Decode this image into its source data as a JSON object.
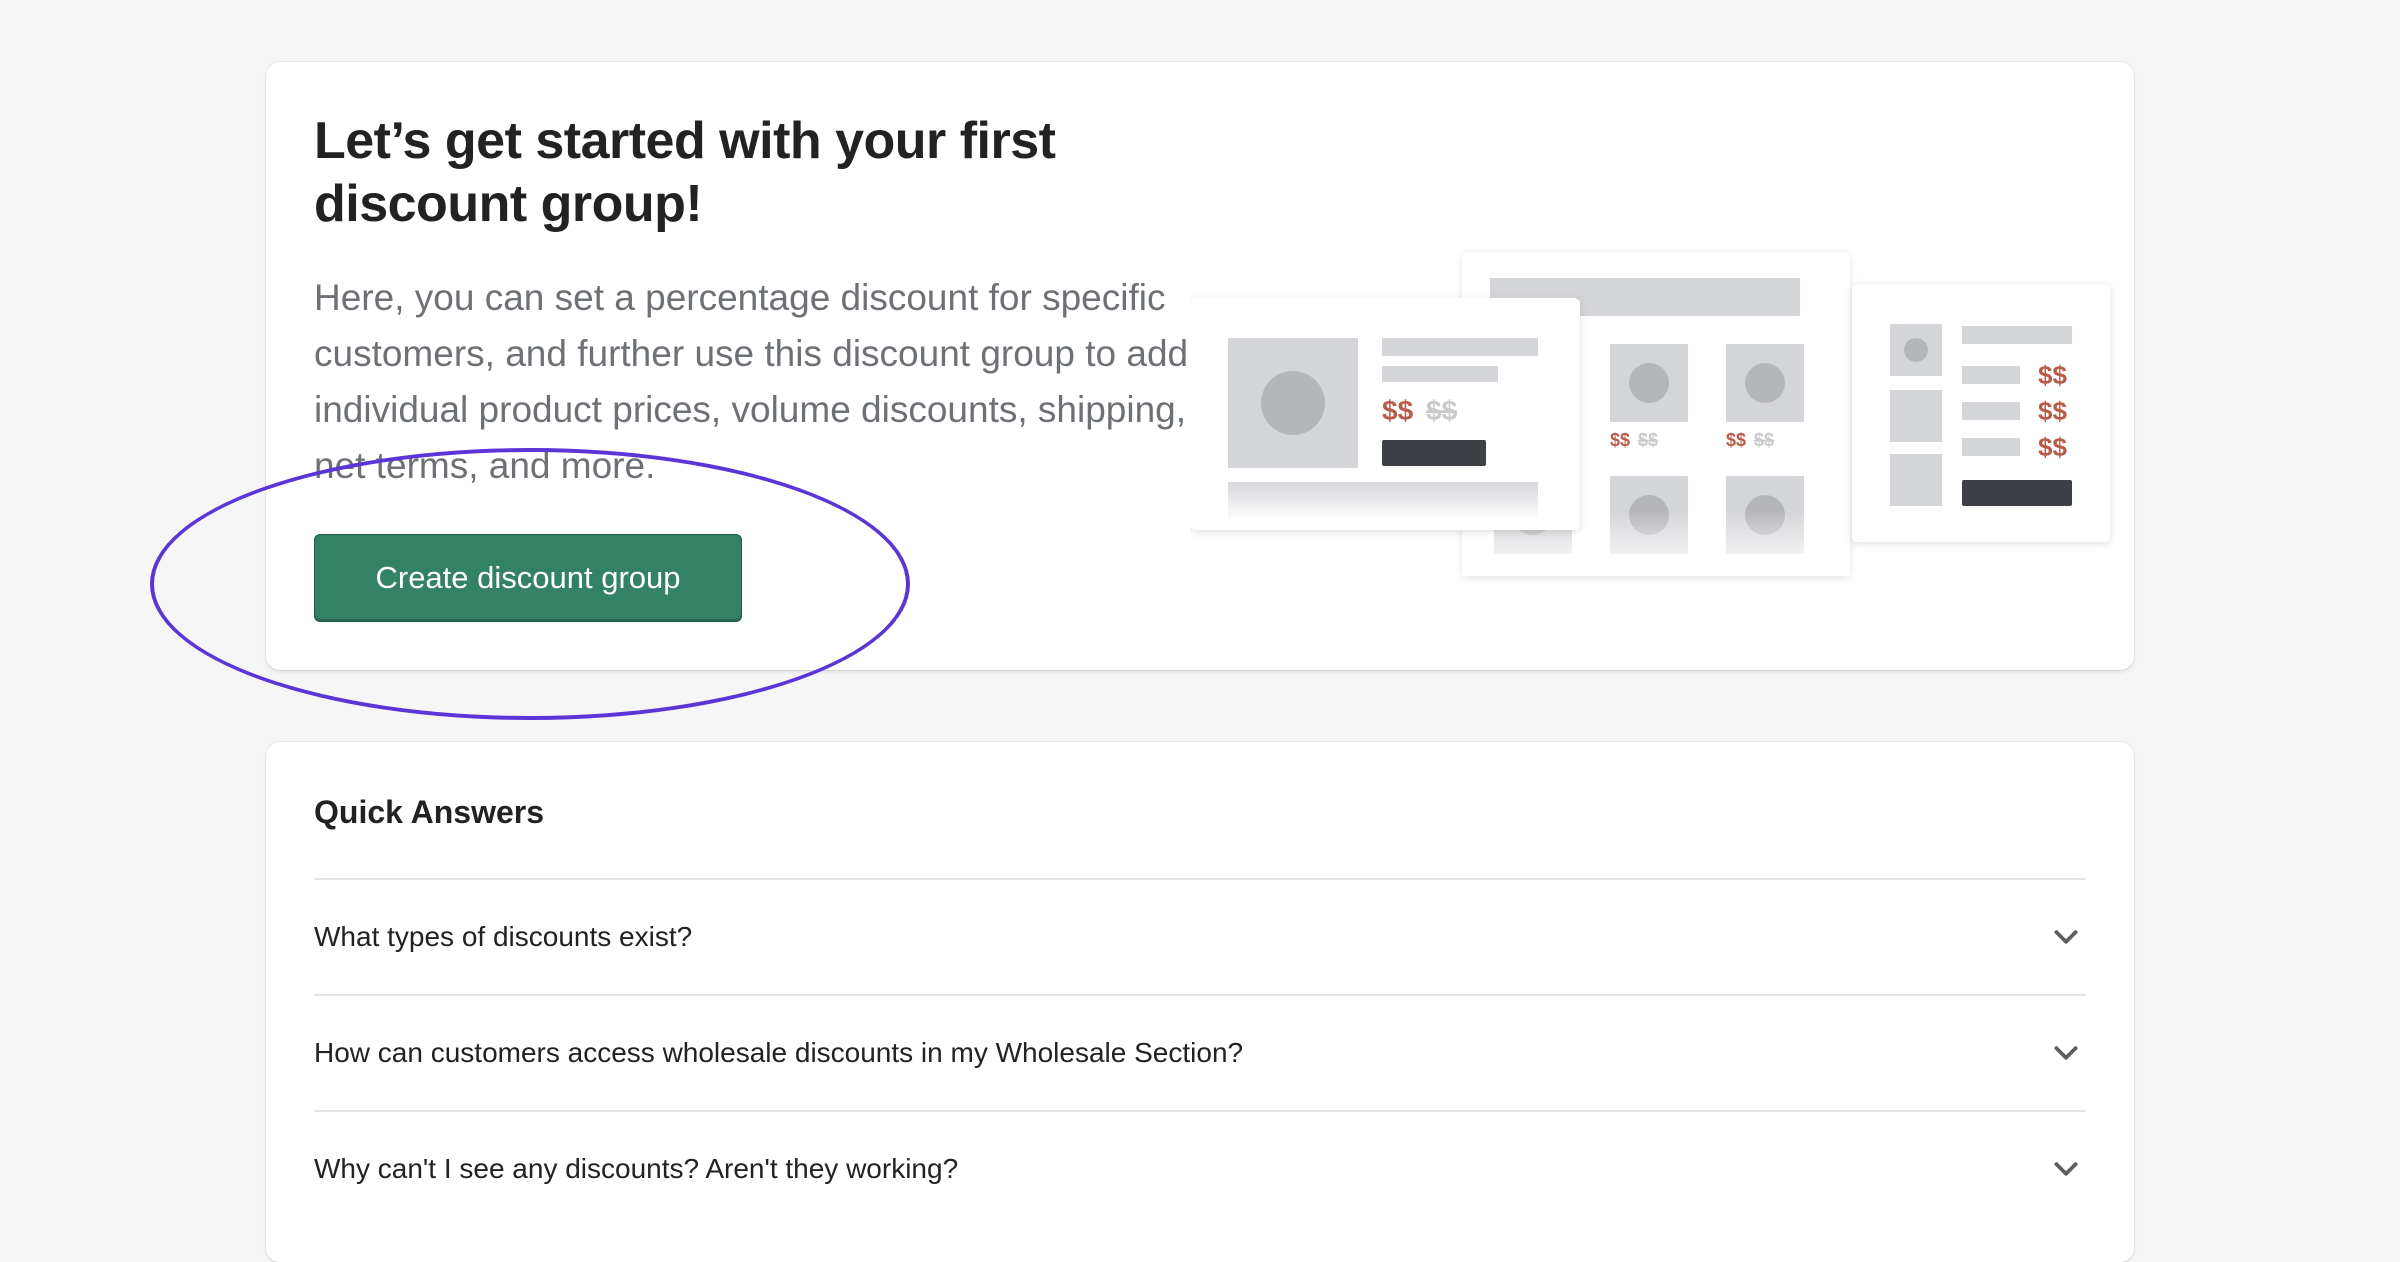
{
  "hero": {
    "title": "Let’s get started with your first discount group!",
    "description": "Here, you can set a percentage discount for specific customers, and further use this discount group to add individual product prices, volume discounts, shipping, net terms, and more.",
    "primary_button_label": "Create discount group",
    "illustration": {
      "price_text": "$$",
      "accent_color": "#b85c4a",
      "muted_color": "#c9c9cc"
    }
  },
  "quick_answers": {
    "title": "Quick Answers",
    "items": [
      {
        "question": "What types of discounts exist?",
        "icon": "chevron-down-icon"
      },
      {
        "question": "How can customers access wholesale discounts in my Wholesale Section?",
        "icon": "chevron-down-icon"
      },
      {
        "question": "Why can't I see any discounts? Aren't they working?",
        "icon": "chevron-down-icon"
      }
    ]
  },
  "colors": {
    "page_background": "#f6f6f7",
    "primary": "#348265",
    "annotation": "#5b35d5",
    "text": "#202223",
    "subdued_text": "#6d7175"
  }
}
